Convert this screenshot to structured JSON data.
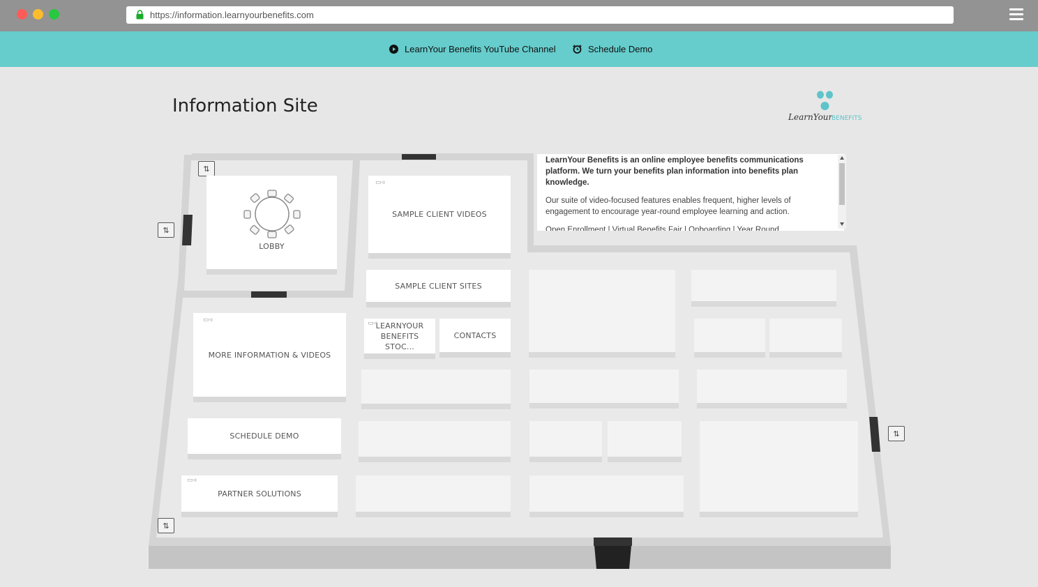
{
  "browser": {
    "url": "https://information.learnyourbenefits.com"
  },
  "topbar": {
    "youtube_label": "LearnYour Benefits YouTube Channel",
    "schedule_label": "Schedule Demo"
  },
  "page": {
    "title": "Information Site",
    "logo_text": "LearnYour BENEFITS"
  },
  "info_panel": {
    "intro": "LearnYour Benefits is an online employee benefits communications platform. We turn your benefits plan information into benefits plan knowledge.",
    "body": "Our suite of video-focused features enables frequent, higher levels of engagement to encourage year-round employee learning and action.",
    "more": "Open Enrollment | Virtual Benefits Fair | Onboarding | Year Round"
  },
  "rooms": {
    "lobby": "LOBBY",
    "sample_client_videos": "SAMPLE CLIENT VIDEOS",
    "sample_client_sites": "SAMPLE CLIENT SITES",
    "stock": "LEARNYOUR BENEFITS STOC...",
    "contacts": "CONTACTS",
    "more_info": "MORE INFORMATION & VIDEOS",
    "schedule_demo": "SCHEDULE DEMO",
    "partner_solutions": "PARTNER SOLUTIONS"
  },
  "colors": {
    "teal": "#66cccc",
    "chrome": "#939393",
    "background": "#e7e7e7"
  }
}
